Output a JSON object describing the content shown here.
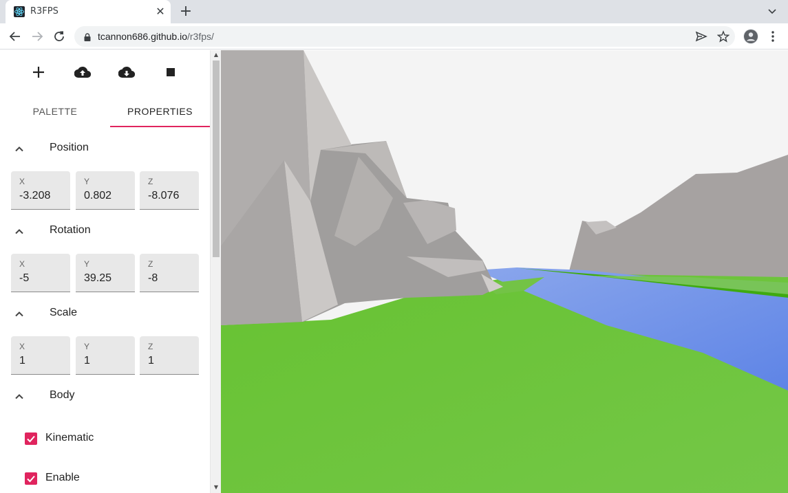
{
  "browser": {
    "tab_title": "R3FPS",
    "tab_close": "✕",
    "new_tab": "+",
    "url_host": "tcannon686.github.io",
    "url_path": "/r3fps/"
  },
  "toolbar": {
    "add_icon": "plus-icon",
    "upload_icon": "cloud-upload-icon",
    "download_icon": "cloud-download-icon",
    "stop_icon": "stop-icon"
  },
  "tabs": [
    {
      "label": "PALETTE",
      "active": false
    },
    {
      "label": "PROPERTIES",
      "active": true
    }
  ],
  "colors": {
    "accent": "#e0245e",
    "ground": "#6cc33a",
    "water": "#6f8fe6",
    "rock": "#a9a6a5"
  },
  "properties": {
    "position": {
      "title": "Position",
      "x": {
        "label": "X",
        "value": "-3.208"
      },
      "y": {
        "label": "Y",
        "value": "0.802"
      },
      "z": {
        "label": "Z",
        "value": "-8.076"
      }
    },
    "rotation": {
      "title": "Rotation",
      "x": {
        "label": "X",
        "value": "-5"
      },
      "y": {
        "label": "Y",
        "value": "39.25"
      },
      "z": {
        "label": "Z",
        "value": "-8"
      }
    },
    "scale": {
      "title": "Scale",
      "x": {
        "label": "X",
        "value": "1"
      },
      "y": {
        "label": "Y",
        "value": "1"
      },
      "z": {
        "label": "Z",
        "value": "1"
      }
    },
    "body": {
      "title": "Body",
      "kinematic": {
        "label": "Kinematic",
        "checked": true
      },
      "enable": {
        "label": "Enable",
        "checked": true
      }
    }
  }
}
